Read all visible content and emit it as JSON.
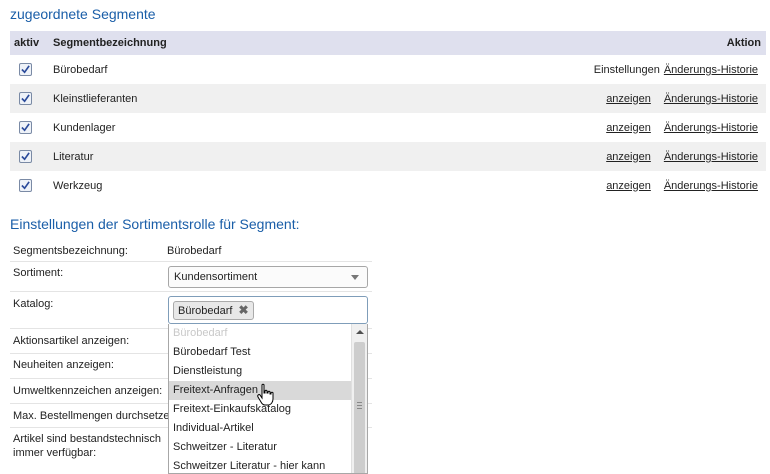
{
  "assigned": {
    "title": "zugeordnete Segmente",
    "col_aktiv": "aktiv",
    "col_name": "Segmentbezeichnung",
    "col_action": "Aktion",
    "rows": [
      {
        "name": "Bürobedarf",
        "action1": "Einstellungen",
        "action2": "Änderungs-Historie"
      },
      {
        "name": "Kleinstlieferanten",
        "action1": "anzeigen",
        "action2": "Änderungs-Historie"
      },
      {
        "name": "Kundenlager",
        "action1": "anzeigen",
        "action2": "Änderungs-Historie"
      },
      {
        "name": "Literatur",
        "action1": "anzeigen",
        "action2": "Änderungs-Historie"
      },
      {
        "name": "Werkzeug",
        "action1": "anzeigen",
        "action2": "Änderungs-Historie"
      }
    ]
  },
  "settings": {
    "title": "Einstellungen der Sortimentsrolle für Segment:",
    "segment_label": "Segmentsbezeichnung:",
    "segment_value": "Bürobedarf",
    "sortiment_label": "Sortiment:",
    "sortiment_value": "Kundensortiment",
    "katalog_label": "Katalog:",
    "katalog_tag": "Bürobedarf",
    "aktionsartikel_label": "Aktionsartikel anzeigen:",
    "neuheiten_label": "Neuheiten anzeigen:",
    "umwelt_label": "Umweltkennzeichen anzeigen:",
    "maxbestell_label": "Max. Bestellmengen durchsetzen",
    "artikel_label_1": "Artikel sind bestandstechnisch",
    "artikel_label_2": "immer verfügbar:"
  },
  "katalog_options": [
    "Bürobedarf",
    "Bürobedarf Test",
    "Dienstleistung",
    "Freitext-Anfragen",
    "Freitext-Einkaufskatalog",
    "Individual-Artikel",
    "Schweitzer - Literatur",
    "Schweitzer Literatur - hier kann"
  ],
  "icons": {
    "checkbox": "checkmark-icon",
    "dropdown": "chevron-down-icon",
    "remove_tag": "close-icon",
    "cursor": "hand-pointer-icon"
  },
  "colors": {
    "title": "#1a5ea8",
    "header_bg": "#dfe0ee",
    "row_alt_bg": "#f0f0f0",
    "highlight_option": "#d9d9d9"
  }
}
